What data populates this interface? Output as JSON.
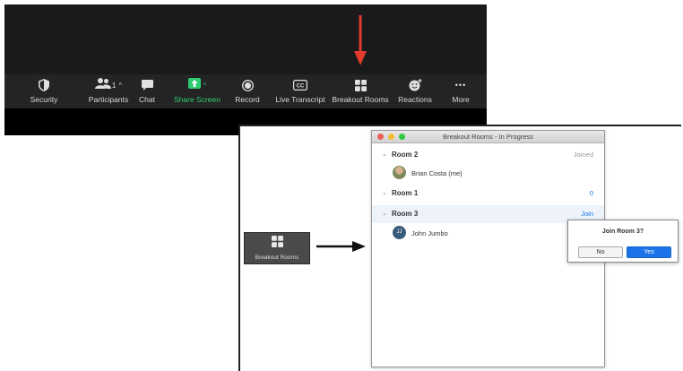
{
  "toolbar": {
    "items": [
      {
        "label": "Security",
        "icon": "shield-icon"
      },
      {
        "label": "Participants",
        "icon": "people-icon",
        "count": "1"
      },
      {
        "label": "Chat",
        "icon": "chat-bubble-icon"
      },
      {
        "label": "Share Screen",
        "icon": "share-up-arrow-icon"
      },
      {
        "label": "Record",
        "icon": "record-icon"
      },
      {
        "label": "Live Transcript",
        "icon": "cc-icon"
      },
      {
        "label": "Breakout Rooms",
        "icon": "four-squares-icon"
      },
      {
        "label": "Reactions",
        "icon": "smiley-plus-icon"
      },
      {
        "label": "More",
        "icon": "ellipsis-icon"
      }
    ],
    "caret": "^",
    "ellipsis": "•••"
  },
  "tile": {
    "label": "Breakout Rooms"
  },
  "window": {
    "title": "Breakout Rooms - In Progress",
    "rooms": [
      {
        "name": "Room 2",
        "status": "Joined",
        "members": [
          "Brian Costa (me)"
        ]
      },
      {
        "name": "Room 1",
        "status": "0",
        "members": []
      },
      {
        "name": "Room 3",
        "status": "Join",
        "members": [
          "John Jumbo"
        ]
      }
    ],
    "avatar_initials": "JJ"
  },
  "dialog": {
    "question": "Join Room 3?",
    "no": "No",
    "yes": "Yes"
  },
  "colors": {
    "accent_green": "#2ecc71",
    "accent_blue": "#1a73e8",
    "arrow_red": "#e23b2e"
  }
}
